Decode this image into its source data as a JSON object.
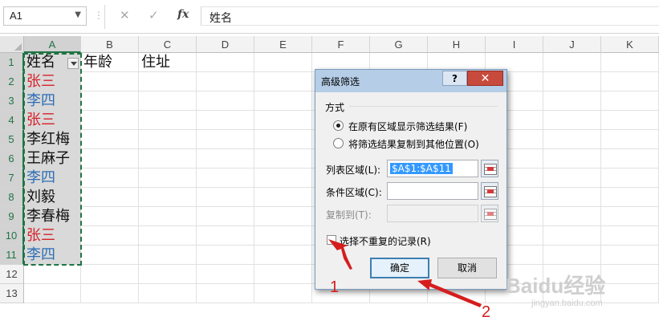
{
  "formula_bar": {
    "name_box": "A1",
    "cancel_glyph": "✕",
    "enter_glyph": "✓",
    "fx_label": "fx",
    "content": "姓名"
  },
  "columns": [
    "A",
    "B",
    "C",
    "D",
    "E",
    "F",
    "G",
    "H",
    "I",
    "J",
    "K"
  ],
  "selected_column": "A",
  "rows": [
    "1",
    "2",
    "3",
    "4",
    "5",
    "6",
    "7",
    "8",
    "9",
    "10",
    "11",
    "12",
    "13"
  ],
  "cells": {
    "header": [
      "姓名",
      "年龄",
      "住址"
    ],
    "names": [
      {
        "text": "张三",
        "color": "#d7212a"
      },
      {
        "text": "李四",
        "color": "#2e6eb5"
      },
      {
        "text": "张三",
        "color": "#d7212a"
      },
      {
        "text": "李红梅",
        "color": "#111111"
      },
      {
        "text": "王麻子",
        "color": "#111111"
      },
      {
        "text": "李四",
        "color": "#2e6eb5"
      },
      {
        "text": "刘毅",
        "color": "#111111"
      },
      {
        "text": "李春梅",
        "color": "#111111"
      },
      {
        "text": "张三",
        "color": "#d7212a"
      },
      {
        "text": "李四",
        "color": "#2e6eb5"
      }
    ]
  },
  "dialog": {
    "title": "高级筛选",
    "help_label": "?",
    "close_label": "✕",
    "group_label": "方式",
    "radio_in_place": "在原有区域显示筛选结果(F)",
    "radio_copy": "将筛选结果复制到其他位置(O)",
    "selected_radio": "in_place",
    "list_range_label": "列表区域(L):",
    "list_range_value": "$A$1:$A$11",
    "criteria_range_label": "条件区域(C):",
    "criteria_range_value": "",
    "copy_to_label": "复制到(T):",
    "copy_to_value": "",
    "unique_checkbox_label": "选择不重复的记录(R)",
    "unique_checked": false,
    "ok_label": "确定",
    "cancel_label": "取消"
  },
  "annotations": {
    "step1": "1",
    "step2": "2",
    "color": "#d51d1d"
  },
  "watermark": {
    "brand": "Baidu经验",
    "url": "jingyan.baidu.com"
  },
  "colors": {
    "accent_green": "#217346",
    "dialog_title_bg": "#b5cde6",
    "close_button": "#c74a3c"
  }
}
